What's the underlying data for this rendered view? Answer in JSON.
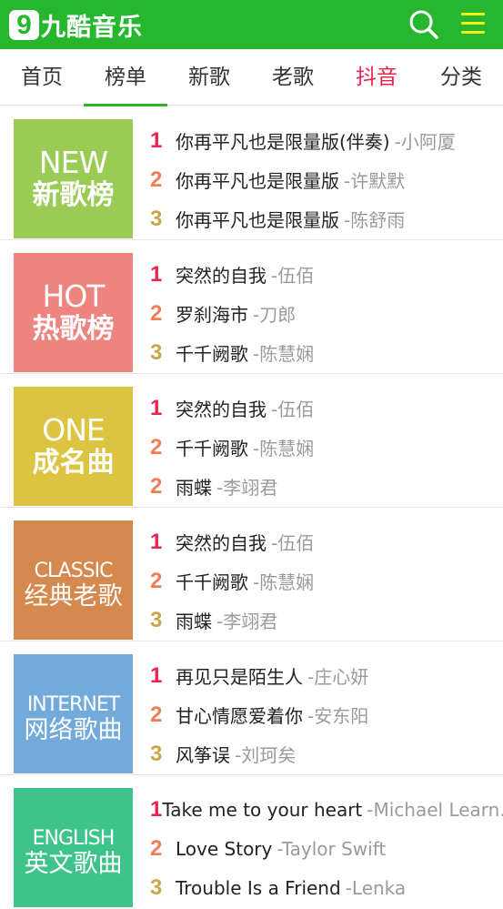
{
  "header": {
    "logo_badge": "9",
    "logo_text": "九酷音乐",
    "bg_color": "#26b72f",
    "icons": [
      "search-icon",
      "menu-icon"
    ]
  },
  "tabs": [
    {
      "label": "首页"
    },
    {
      "label": "榜单"
    },
    {
      "label": "新歌"
    },
    {
      "label": "老歌"
    },
    {
      "label": "抖音"
    },
    {
      "label": "分类"
    }
  ],
  "active_tab": "榜单",
  "charts": [
    {
      "en": "NEW",
      "zh": "新歌榜",
      "color": "#9acb55",
      "songs": [
        {
          "rank": "1",
          "title": "你再平凡也是限量版(伴奏)",
          "artist": "-小阿厦"
        },
        {
          "rank": "2",
          "title": "你再平凡也是限量版",
          "artist": "-许默默"
        },
        {
          "rank": "3",
          "title": "你再平凡也是限量版",
          "artist": "-陈舒雨"
        }
      ]
    },
    {
      "en": "HOT",
      "zh": "热歌榜",
      "color": "#ee8480",
      "songs": [
        {
          "rank": "1",
          "title": "突然的自我",
          "artist": "-伍佰"
        },
        {
          "rank": "2",
          "title": "罗刹海市",
          "artist": "-刀郎"
        },
        {
          "rank": "3",
          "title": "千千阙歌",
          "artist": "-陈慧娴"
        }
      ]
    },
    {
      "en": "ONE",
      "zh": "成名曲",
      "color": "#dcc340",
      "songs": [
        {
          "rank": "1",
          "title": "突然的自我",
          "artist": "-伍佰"
        },
        {
          "rank": "2",
          "title": "千千阙歌",
          "artist": "-陈慧娴"
        },
        {
          "rank": "2",
          "title": "雨蝶",
          "artist": "-李翊君"
        }
      ]
    },
    {
      "en": "CLASSIC",
      "zh": "经典老歌",
      "color": "#d6894e",
      "songs": [
        {
          "rank": "1",
          "title": "突然的自我",
          "artist": "-伍佰"
        },
        {
          "rank": "2",
          "title": "千千阙歌",
          "artist": "-陈慧娴"
        },
        {
          "rank": "3",
          "title": "雨蝶",
          "artist": "-李翊君"
        }
      ]
    },
    {
      "en": "INTERNET",
      "zh": "网络歌曲",
      "color": "#72aadb",
      "songs": [
        {
          "rank": "1",
          "title": "再见只是陌生人",
          "artist": "-庄心妍"
        },
        {
          "rank": "2",
          "title": "甘心情愿爱着你",
          "artist": "-安东阳"
        },
        {
          "rank": "3",
          "title": "风筝误",
          "artist": "-刘珂矣"
        }
      ]
    },
    {
      "en": "ENGLISH",
      "zh": "英文歌曲",
      "color": "#3ec48b",
      "songs": [
        {
          "rank": "1",
          "title": "Take me to your heart",
          "artist": "-Michael Learn..."
        },
        {
          "rank": "2",
          "title": "Love Story",
          "artist": "-Taylor Swift"
        },
        {
          "rank": "3",
          "title": "Trouble Is a Friend",
          "artist": "-Lenka"
        }
      ]
    }
  ]
}
